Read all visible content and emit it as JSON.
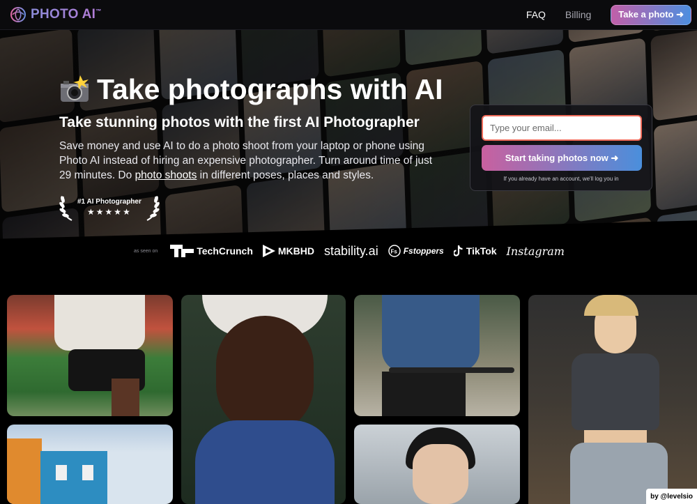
{
  "nav": {
    "logo_text": "PHOTO AI",
    "logo_tm": "™",
    "links": [
      "FAQ",
      "Billing"
    ],
    "cta": "Take a photo ➜"
  },
  "hero": {
    "title": "Take photographs with AI",
    "subtitle": "Take stunning photos with the first AI Photographer",
    "description_before": "Save money and use AI to do a photo shoot from your laptop or phone using Photo AI instead of hiring an expensive photographer. Turn around time of just 29 minutes. Do ",
    "description_link": "photo shoots",
    "description_after": " in different poses, places and styles.",
    "award_title": "#1 AI Photographer",
    "award_stars": "★★★★★"
  },
  "signup": {
    "email_placeholder": "Type your email...",
    "button": "Start taking photos now ➜",
    "note": "If you already have an account, we'll log you in"
  },
  "as_seen_on": {
    "label": "as seen on",
    "brands": [
      "TechCrunch",
      "MKBHD",
      "stability.ai",
      "Fstoppers",
      "TikTok",
      "Instagram"
    ]
  },
  "footer": {
    "credit": "by @levelsio"
  },
  "colors": {
    "accent_pink": "#c9609f",
    "accent_blue": "#4a8fdc",
    "input_border": "#ef6b5a"
  }
}
